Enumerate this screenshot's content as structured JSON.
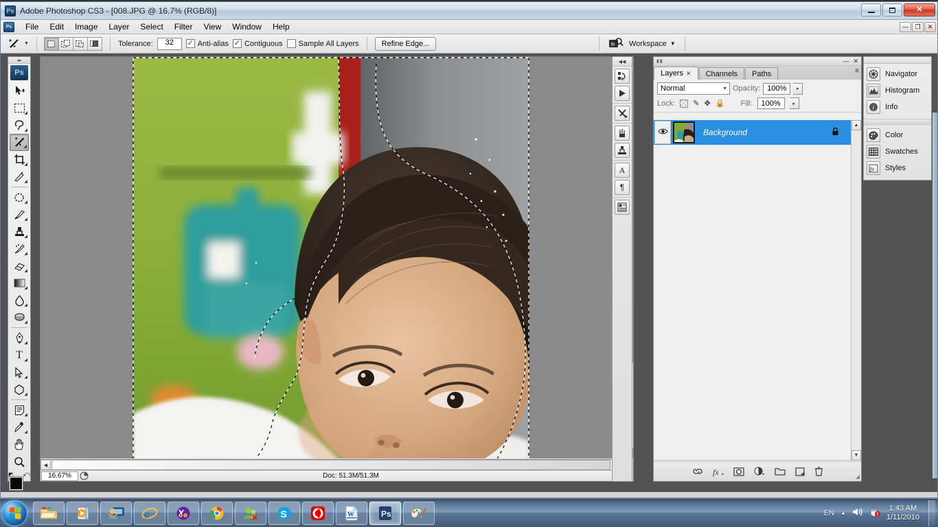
{
  "window": {
    "title": "Adobe Photoshop CS3 - [008.JPG @ 16.7% (RGB/8)]",
    "logo_text": "Ps",
    "buttons": {
      "minimize": "minimize-button",
      "maximize": "maximize-button",
      "close": "close-button",
      "close_glyph": "✕"
    }
  },
  "menubar": {
    "doc_icon": "Ps",
    "items": [
      "File",
      "Edit",
      "Image",
      "Layer",
      "Select",
      "Filter",
      "View",
      "Window",
      "Help"
    ],
    "window_controls": [
      "—",
      "❐",
      "✕"
    ]
  },
  "options_bar": {
    "tool_icon": "magic-wand-icon",
    "tool_caret": "▼",
    "selection_modes": [
      "new-selection",
      "add-to-selection",
      "subtract-from-selection",
      "intersect-with-selection"
    ],
    "active_selection_mode": 0,
    "tolerance_label": "Tolerance:",
    "tolerance_value": "32",
    "anti_alias_label": "Anti-alias",
    "anti_alias_checked": true,
    "contiguous_label": "Contiguous",
    "contiguous_checked": true,
    "sample_all_layers_label": "Sample All Layers",
    "sample_all_layers_checked": false,
    "refine_edge_label": "Refine Edge...",
    "bridge_icon": "Br",
    "workspace_label": "Workspace",
    "workspace_caret": "▼"
  },
  "toolbar": {
    "badge": "Ps",
    "grip": "▸▸",
    "tools": [
      {
        "name": "move-tool",
        "glyph": "move"
      },
      {
        "name": "rectangular-marquee-tool",
        "glyph": "marquee"
      },
      {
        "name": "lasso-tool",
        "glyph": "lasso"
      },
      {
        "name": "magic-wand-tool",
        "glyph": "wand",
        "active": true
      },
      {
        "name": "crop-tool",
        "glyph": "crop"
      },
      {
        "name": "slice-tool",
        "glyph": "slice"
      },
      {
        "name": "spot-healing-brush-tool",
        "glyph": "heal"
      },
      {
        "name": "brush-tool",
        "glyph": "brush"
      },
      {
        "name": "clone-stamp-tool",
        "glyph": "stamp"
      },
      {
        "name": "history-brush-tool",
        "glyph": "history"
      },
      {
        "name": "eraser-tool",
        "glyph": "eraser"
      },
      {
        "name": "gradient-tool",
        "glyph": "gradient"
      },
      {
        "name": "blur-tool",
        "glyph": "blur"
      },
      {
        "name": "dodge-tool",
        "glyph": "dodge"
      },
      {
        "name": "pen-tool",
        "glyph": "pen"
      },
      {
        "name": "horizontal-type-tool",
        "glyph": "T"
      },
      {
        "name": "path-selection-tool",
        "glyph": "arrow"
      },
      {
        "name": "shape-tool",
        "glyph": "shape"
      },
      {
        "name": "notes-tool",
        "glyph": "note"
      },
      {
        "name": "eyedropper-tool",
        "glyph": "dropper"
      },
      {
        "name": "hand-tool",
        "glyph": "hand"
      },
      {
        "name": "zoom-tool",
        "glyph": "zoom"
      }
    ],
    "foreground_color": "#070707",
    "background_color": "#3b2408",
    "quickmask_name": "edit-in-quick-mask-mode"
  },
  "document": {
    "zoom_level": "16.67%",
    "doc_size": "Doc: 51.3M/51.3M",
    "status_tri": "▶",
    "image_alt": "baby photograph with active marching-ants selection",
    "colors": {
      "green_wall": "#8fae3c",
      "red_stripe": "#a81f19",
      "gray_wall": "#86898c",
      "teal_object": "#2f9c9c",
      "skin": "#d8ab86",
      "shirt": "#f0f0ee"
    }
  },
  "icon_dock": {
    "head_arrows": "◀◀",
    "groups": [
      [
        {
          "name": "history-panel-icon",
          "glyph": "history"
        },
        {
          "name": "actions-panel-icon",
          "glyph": "play"
        }
      ],
      [
        {
          "name": "tool-presets-panel-icon",
          "glyph": "tools"
        }
      ],
      [
        {
          "name": "brushes-panel-icon",
          "glyph": "brushes"
        },
        {
          "name": "clone-source-panel-icon",
          "glyph": "clone"
        }
      ],
      [
        {
          "name": "character-panel-icon",
          "glyph": "A"
        },
        {
          "name": "paragraph-panel-icon",
          "glyph": "¶"
        }
      ],
      [
        {
          "name": "layer-comps-panel-icon",
          "glyph": "comps"
        }
      ]
    ]
  },
  "layers_panel": {
    "tabs": [
      {
        "label": "Layers",
        "active": true,
        "closable": true
      },
      {
        "label": "Channels",
        "active": false,
        "closable": false
      },
      {
        "label": "Paths",
        "active": false,
        "closable": false
      }
    ],
    "tab_close_glyph": "✕",
    "menu_glyph": "≡",
    "minimize_glyph": "—",
    "close_glyph": "✕",
    "blend_mode": "Normal",
    "blend_caret": "▼",
    "opacity_label": "Opacity:",
    "opacity_value": "100%",
    "fill_label": "Fill:",
    "fill_value": "100%",
    "spinner_glyph": "▸",
    "lock_label": "Lock:",
    "lock_icons": [
      "lock-transparent-pixels",
      "lock-image-pixels",
      "lock-position",
      "lock-all"
    ],
    "layers": [
      {
        "name": "Background",
        "selected": true,
        "visible": true,
        "locked": true
      }
    ],
    "footer_icons": [
      {
        "name": "link-layers-icon",
        "glyph": "🔗"
      },
      {
        "name": "layer-style-fx-icon",
        "glyph": "fx"
      },
      {
        "name": "add-layer-mask-icon",
        "glyph": "mask"
      },
      {
        "name": "new-adjustment-layer-icon",
        "glyph": "adjust"
      },
      {
        "name": "new-group-icon",
        "glyph": "folder"
      },
      {
        "name": "new-layer-icon",
        "glyph": "new"
      },
      {
        "name": "delete-layer-icon",
        "glyph": "trash"
      }
    ]
  },
  "mini_dock": {
    "groups": [
      [
        {
          "label": "Navigator",
          "icon": "navigator-icon"
        },
        {
          "label": "Histogram",
          "icon": "histogram-icon"
        },
        {
          "label": "Info",
          "icon": "info-icon"
        }
      ],
      [
        {
          "label": "Color",
          "icon": "color-icon"
        },
        {
          "label": "Swatches",
          "icon": "swatches-icon"
        },
        {
          "label": "Styles",
          "icon": "styles-icon"
        }
      ]
    ]
  },
  "taskbar": {
    "start_name": "start-orb",
    "buttons": [
      {
        "name": "taskbar-windows-explorer",
        "icon": "folder"
      },
      {
        "name": "taskbar-windows-media-player",
        "icon": "media"
      },
      {
        "name": "taskbar-remote-assistance",
        "icon": "remote"
      },
      {
        "name": "taskbar-internet-explorer",
        "icon": "ie"
      },
      {
        "name": "taskbar-yahoo-messenger",
        "icon": "yahoo"
      },
      {
        "name": "taskbar-google-chrome",
        "icon": "chrome"
      },
      {
        "name": "taskbar-windows-live-messenger",
        "icon": "msn"
      },
      {
        "name": "taskbar-skype",
        "icon": "skype"
      },
      {
        "name": "taskbar-vodafone",
        "icon": "vodafone"
      },
      {
        "name": "taskbar-microsoft-word",
        "icon": "word"
      },
      {
        "name": "taskbar-adobe-photoshop",
        "icon": "ps",
        "active": true
      },
      {
        "name": "taskbar-paint",
        "icon": "paint"
      }
    ],
    "tray": {
      "language": "EN",
      "show_hidden_glyph": "▲",
      "volume_name": "volume-icon",
      "action_center_name": "action-center-icon",
      "time": "1:43 AM",
      "date": "1/11/2010"
    }
  }
}
